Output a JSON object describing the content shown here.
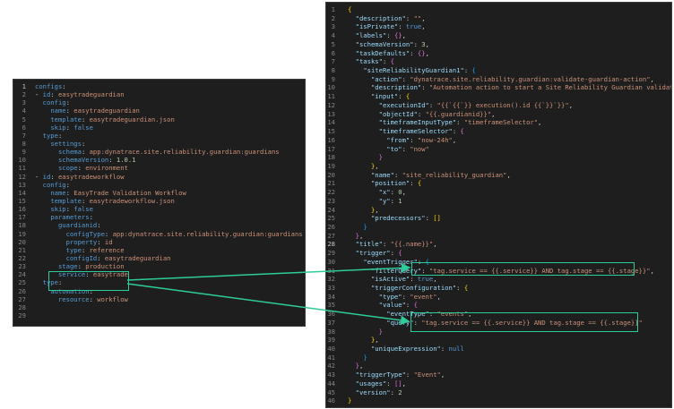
{
  "yaml": {
    "line_numbers": [
      "1",
      "2",
      "3",
      "4",
      "5",
      "6",
      "7",
      "8",
      "9",
      "10",
      "11",
      "12",
      "13",
      "14",
      "15",
      "16",
      "17",
      "18",
      "19",
      "20",
      "21",
      "22",
      "23",
      "24",
      "25",
      "26",
      "27",
      "28",
      "29"
    ],
    "lines": [
      [
        [
          "k",
          "configs"
        ],
        [
          "p",
          ":"
        ]
      ],
      [
        [
          "p",
          "- "
        ],
        [
          "k",
          "id"
        ],
        [
          "p",
          ": "
        ],
        [
          "s",
          "easytradeguardian"
        ]
      ],
      [
        [
          "p",
          "  "
        ],
        [
          "k",
          "config"
        ],
        [
          "p",
          ":"
        ]
      ],
      [
        [
          "p",
          "    "
        ],
        [
          "k",
          "name"
        ],
        [
          "p",
          ": "
        ],
        [
          "s",
          "easytradeguardian"
        ]
      ],
      [
        [
          "p",
          "    "
        ],
        [
          "k",
          "template"
        ],
        [
          "p",
          ": "
        ],
        [
          "s",
          "easytradeguardian.json"
        ]
      ],
      [
        [
          "p",
          "    "
        ],
        [
          "k",
          "skip"
        ],
        [
          "p",
          ": "
        ],
        [
          "b",
          "false"
        ]
      ],
      [
        [
          "p",
          "  "
        ],
        [
          "k",
          "type"
        ],
        [
          "p",
          ":"
        ]
      ],
      [
        [
          "p",
          "    "
        ],
        [
          "k",
          "settings"
        ],
        [
          "p",
          ":"
        ]
      ],
      [
        [
          "p",
          "      "
        ],
        [
          "k",
          "schema"
        ],
        [
          "p",
          ": "
        ],
        [
          "s",
          "app:dynatrace.site.reliability.guardian:guardians"
        ]
      ],
      [
        [
          "p",
          "      "
        ],
        [
          "k",
          "schemaVersion"
        ],
        [
          "p",
          ": "
        ],
        [
          "n",
          "1.0.1"
        ]
      ],
      [
        [
          "p",
          "      "
        ],
        [
          "k",
          "scope"
        ],
        [
          "p",
          ": "
        ],
        [
          "s",
          "environment"
        ]
      ],
      [
        [
          "p",
          "- "
        ],
        [
          "k",
          "id"
        ],
        [
          "p",
          ": "
        ],
        [
          "s",
          "easytradeworkflow"
        ]
      ],
      [
        [
          "p",
          "  "
        ],
        [
          "k",
          "config"
        ],
        [
          "p",
          ":"
        ]
      ],
      [
        [
          "p",
          "    "
        ],
        [
          "k",
          "name"
        ],
        [
          "p",
          ": "
        ],
        [
          "s",
          "EasyTrade Validation Workflow"
        ]
      ],
      [
        [
          "p",
          "    "
        ],
        [
          "k",
          "template"
        ],
        [
          "p",
          ": "
        ],
        [
          "s",
          "easytradeworkflow.json"
        ]
      ],
      [
        [
          "p",
          "    "
        ],
        [
          "k",
          "skip"
        ],
        [
          "p",
          ": "
        ],
        [
          "b",
          "false"
        ]
      ],
      [
        [
          "p",
          "    "
        ],
        [
          "k",
          "parameters"
        ],
        [
          "p",
          ":"
        ]
      ],
      [
        [
          "p",
          "      "
        ],
        [
          "k",
          "guardianid"
        ],
        [
          "p",
          ":"
        ]
      ],
      [
        [
          "p",
          "        "
        ],
        [
          "k",
          "configType"
        ],
        [
          "p",
          ": "
        ],
        [
          "s",
          "app:dynatrace.site.reliability.guardian:guardians"
        ]
      ],
      [
        [
          "p",
          "        "
        ],
        [
          "k",
          "property"
        ],
        [
          "p",
          ": "
        ],
        [
          "s",
          "id"
        ]
      ],
      [
        [
          "p",
          "        "
        ],
        [
          "k",
          "type"
        ],
        [
          "p",
          ": "
        ],
        [
          "s",
          "reference"
        ]
      ],
      [
        [
          "p",
          "        "
        ],
        [
          "k",
          "configId"
        ],
        [
          "p",
          ": "
        ],
        [
          "s",
          "easytradeguardian"
        ]
      ],
      [
        [
          "p",
          "      "
        ],
        [
          "k",
          "stage"
        ],
        [
          "p",
          ": "
        ],
        [
          "s",
          "production"
        ]
      ],
      [
        [
          "p",
          "      "
        ],
        [
          "k",
          "service"
        ],
        [
          "p",
          ": "
        ],
        [
          "s",
          "easytrade"
        ]
      ],
      [
        [
          "p",
          "  "
        ],
        [
          "k",
          "type"
        ],
        [
          "p",
          ":"
        ]
      ],
      [
        [
          "p",
          "    "
        ],
        [
          "k",
          "automation"
        ],
        [
          "p",
          ":"
        ]
      ],
      [
        [
          "p",
          "      "
        ],
        [
          "k",
          "resource"
        ],
        [
          "p",
          ": "
        ],
        [
          "s",
          "workflow"
        ]
      ],
      [
        [
          "p",
          ""
        ]
      ],
      [
        [
          "p",
          ""
        ]
      ]
    ]
  },
  "json": {
    "line_numbers": [
      "1",
      "2",
      "3",
      "4",
      "5",
      "6",
      "7",
      "8",
      "9",
      "10",
      "11",
      "12",
      "13",
      "14",
      "15",
      "16",
      "17",
      "18",
      "19",
      "20",
      "21",
      "22",
      "23",
      "24",
      "25",
      "26",
      "27",
      "28",
      "29",
      "30",
      "31",
      "32",
      "33",
      "34",
      "35",
      "36",
      "37",
      "38",
      "39",
      "40",
      "41",
      "42",
      "43",
      "44",
      "45",
      "46"
    ],
    "lines": [
      [
        [
          "br1",
          "{"
        ]
      ],
      [
        [
          "p",
          "  "
        ],
        [
          "jk",
          "\"description\""
        ],
        [
          "p",
          ": "
        ],
        [
          "s",
          "\"\""
        ],
        [
          "p",
          ","
        ]
      ],
      [
        [
          "p",
          "  "
        ],
        [
          "jk",
          "\"isPrivate\""
        ],
        [
          "p",
          ": "
        ],
        [
          "b",
          "true"
        ],
        [
          "p",
          ","
        ]
      ],
      [
        [
          "p",
          "  "
        ],
        [
          "jk",
          "\"labels\""
        ],
        [
          "p",
          ": "
        ],
        [
          "br2",
          "{}"
        ],
        [
          "p",
          ","
        ]
      ],
      [
        [
          "p",
          "  "
        ],
        [
          "jk",
          "\"schemaVersion\""
        ],
        [
          "p",
          ": "
        ],
        [
          "n",
          "3"
        ],
        [
          "p",
          ","
        ]
      ],
      [
        [
          "p",
          "  "
        ],
        [
          "jk",
          "\"taskDefaults\""
        ],
        [
          "p",
          ": "
        ],
        [
          "br2",
          "{}"
        ],
        [
          "p",
          ","
        ]
      ],
      [
        [
          "p",
          "  "
        ],
        [
          "jk",
          "\"tasks\""
        ],
        [
          "p",
          ": "
        ],
        [
          "br2",
          "{"
        ]
      ],
      [
        [
          "p",
          "    "
        ],
        [
          "jk",
          "\"siteReliabilityGuardian1\""
        ],
        [
          "p",
          ": "
        ],
        [
          "br3",
          "{"
        ]
      ],
      [
        [
          "p",
          "      "
        ],
        [
          "jk",
          "\"action\""
        ],
        [
          "p",
          ": "
        ],
        [
          "s",
          "\"dynatrace.site.reliability.guardian:validate-guardian-action\""
        ],
        [
          "p",
          ","
        ]
      ],
      [
        [
          "p",
          "      "
        ],
        [
          "jk",
          "\"description\""
        ],
        [
          "p",
          ": "
        ],
        [
          "s",
          "\"Automation action to start a Site Reliability Guardian validation\""
        ],
        [
          "p",
          ","
        ]
      ],
      [
        [
          "p",
          "      "
        ],
        [
          "jk",
          "\"input\""
        ],
        [
          "p",
          ": "
        ],
        [
          "br1",
          "{"
        ]
      ],
      [
        [
          "p",
          "        "
        ],
        [
          "jk",
          "\"executionId\""
        ],
        [
          "p",
          ": "
        ],
        [
          "s",
          "\"{{`{{`}} execution().id {{`}}`}}\""
        ],
        [
          "p",
          ","
        ]
      ],
      [
        [
          "p",
          "        "
        ],
        [
          "jk",
          "\"objectId\""
        ],
        [
          "p",
          ": "
        ],
        [
          "s",
          "\"{{.guardianid}}\""
        ],
        [
          "p",
          ","
        ]
      ],
      [
        [
          "p",
          "        "
        ],
        [
          "jk",
          "\"timeframeInputType\""
        ],
        [
          "p",
          ": "
        ],
        [
          "s",
          "\"timeframeSelector\""
        ],
        [
          "p",
          ","
        ]
      ],
      [
        [
          "p",
          "        "
        ],
        [
          "jk",
          "\"timeframeSelector\""
        ],
        [
          "p",
          ": "
        ],
        [
          "br2",
          "{"
        ]
      ],
      [
        [
          "p",
          "          "
        ],
        [
          "jk",
          "\"from\""
        ],
        [
          "p",
          ": "
        ],
        [
          "s",
          "\"now-24h\""
        ],
        [
          "p",
          ","
        ]
      ],
      [
        [
          "p",
          "          "
        ],
        [
          "jk",
          "\"to\""
        ],
        [
          "p",
          ": "
        ],
        [
          "s",
          "\"now\""
        ]
      ],
      [
        [
          "p",
          "        "
        ],
        [
          "br2",
          "}"
        ]
      ],
      [
        [
          "p",
          "      "
        ],
        [
          "br1",
          "}"
        ],
        [
          "p",
          ","
        ]
      ],
      [
        [
          "p",
          "      "
        ],
        [
          "jk",
          "\"name\""
        ],
        [
          "p",
          ": "
        ],
        [
          "s",
          "\"site_reliability_guardian\""
        ],
        [
          "p",
          ","
        ]
      ],
      [
        [
          "p",
          "      "
        ],
        [
          "jk",
          "\"position\""
        ],
        [
          "p",
          ": "
        ],
        [
          "br1",
          "{"
        ]
      ],
      [
        [
          "p",
          "        "
        ],
        [
          "jk",
          "\"x\""
        ],
        [
          "p",
          ": "
        ],
        [
          "n",
          "0"
        ],
        [
          "p",
          ","
        ]
      ],
      [
        [
          "p",
          "        "
        ],
        [
          "jk",
          "\"y\""
        ],
        [
          "p",
          ": "
        ],
        [
          "n",
          "1"
        ]
      ],
      [
        [
          "p",
          "      "
        ],
        [
          "br1",
          "}"
        ],
        [
          "p",
          ","
        ]
      ],
      [
        [
          "p",
          "      "
        ],
        [
          "jk",
          "\"predecessors\""
        ],
        [
          "p",
          ": "
        ],
        [
          "br1",
          "[]"
        ]
      ],
      [
        [
          "p",
          "    "
        ],
        [
          "br3",
          "}"
        ]
      ],
      [
        [
          "p",
          "  "
        ],
        [
          "br2",
          "}"
        ],
        [
          "p",
          ","
        ]
      ],
      [
        [
          "p",
          "  "
        ],
        [
          "jk",
          "\"title\""
        ],
        [
          "p",
          ": "
        ],
        [
          "s",
          "\"{{.name}}\""
        ],
        [
          "p",
          ","
        ]
      ],
      [
        [
          "p",
          "  "
        ],
        [
          "jk",
          "\"trigger\""
        ],
        [
          "p",
          ": "
        ],
        [
          "br2",
          "{"
        ]
      ],
      [
        [
          "p",
          "    "
        ],
        [
          "jk",
          "\"eventTrigger\""
        ],
        [
          "p",
          ": "
        ],
        [
          "br3",
          "{"
        ]
      ],
      [
        [
          "p",
          "      "
        ],
        [
          "jk",
          "\"filterQuery\""
        ],
        [
          "p",
          ": "
        ],
        [
          "s",
          "\"tag.service == {{.service}} AND tag.stage == {{.stage}}\""
        ],
        [
          "p",
          ","
        ]
      ],
      [
        [
          "p",
          "      "
        ],
        [
          "jk",
          "\"isActive\""
        ],
        [
          "p",
          ": "
        ],
        [
          "b",
          "true"
        ],
        [
          "p",
          ","
        ]
      ],
      [
        [
          "p",
          "      "
        ],
        [
          "jk",
          "\"triggerConfiguration\""
        ],
        [
          "p",
          ": "
        ],
        [
          "br1",
          "{"
        ]
      ],
      [
        [
          "p",
          "        "
        ],
        [
          "jk",
          "\"type\""
        ],
        [
          "p",
          ": "
        ],
        [
          "s",
          "\"event\""
        ],
        [
          "p",
          ","
        ]
      ],
      [
        [
          "p",
          "        "
        ],
        [
          "jk",
          "\"value\""
        ],
        [
          "p",
          ": "
        ],
        [
          "br2",
          "{"
        ]
      ],
      [
        [
          "p",
          "          "
        ],
        [
          "jk",
          "\"eventType\""
        ],
        [
          "p",
          ": "
        ],
        [
          "s",
          "\"events\""
        ],
        [
          "p",
          ","
        ]
      ],
      [
        [
          "p",
          "          "
        ],
        [
          "jk",
          "\"query\""
        ],
        [
          "p",
          ": "
        ],
        [
          "s",
          "\"tag.service == {{.service}} AND tag.stage == {{.stage}}\""
        ]
      ],
      [
        [
          "p",
          "        "
        ],
        [
          "br2",
          "}"
        ]
      ],
      [
        [
          "p",
          "      "
        ],
        [
          "br1",
          "}"
        ],
        [
          "p",
          ","
        ]
      ],
      [
        [
          "p",
          "      "
        ],
        [
          "jk",
          "\"uniqueExpression\""
        ],
        [
          "p",
          ": "
        ],
        [
          "b",
          "null"
        ]
      ],
      [
        [
          "p",
          "    "
        ],
        [
          "br3",
          "}"
        ]
      ],
      [
        [
          "p",
          "  "
        ],
        [
          "br2",
          "}"
        ],
        [
          "p",
          ","
        ]
      ],
      [
        [
          "p",
          "  "
        ],
        [
          "jk",
          "\"triggerType\""
        ],
        [
          "p",
          ": "
        ],
        [
          "s",
          "\"Event\""
        ],
        [
          "p",
          ","
        ]
      ],
      [
        [
          "p",
          "  "
        ],
        [
          "jk",
          "\"usages\""
        ],
        [
          "p",
          ": "
        ],
        [
          "br2",
          "[]"
        ],
        [
          "p",
          ","
        ]
      ],
      [
        [
          "p",
          "  "
        ],
        [
          "jk",
          "\"version\""
        ],
        [
          "p",
          ": "
        ],
        [
          "n",
          "2"
        ]
      ],
      [
        [
          "br1",
          "}"
        ]
      ]
    ]
  },
  "colors": {
    "highlight": "#2ecc9a",
    "editor_bg": "#1e1e1e",
    "key_yaml": "#569cd6",
    "key_json": "#9cdcfe",
    "string": "#ce9178",
    "number": "#b5cea8"
  },
  "annotations": {
    "arrows": [
      {
        "from": "yaml-highlight-stage-service",
        "to": "json-highlight-filterquery"
      },
      {
        "from": "yaml-highlight-stage-service",
        "to": "json-highlight-query"
      }
    ]
  }
}
